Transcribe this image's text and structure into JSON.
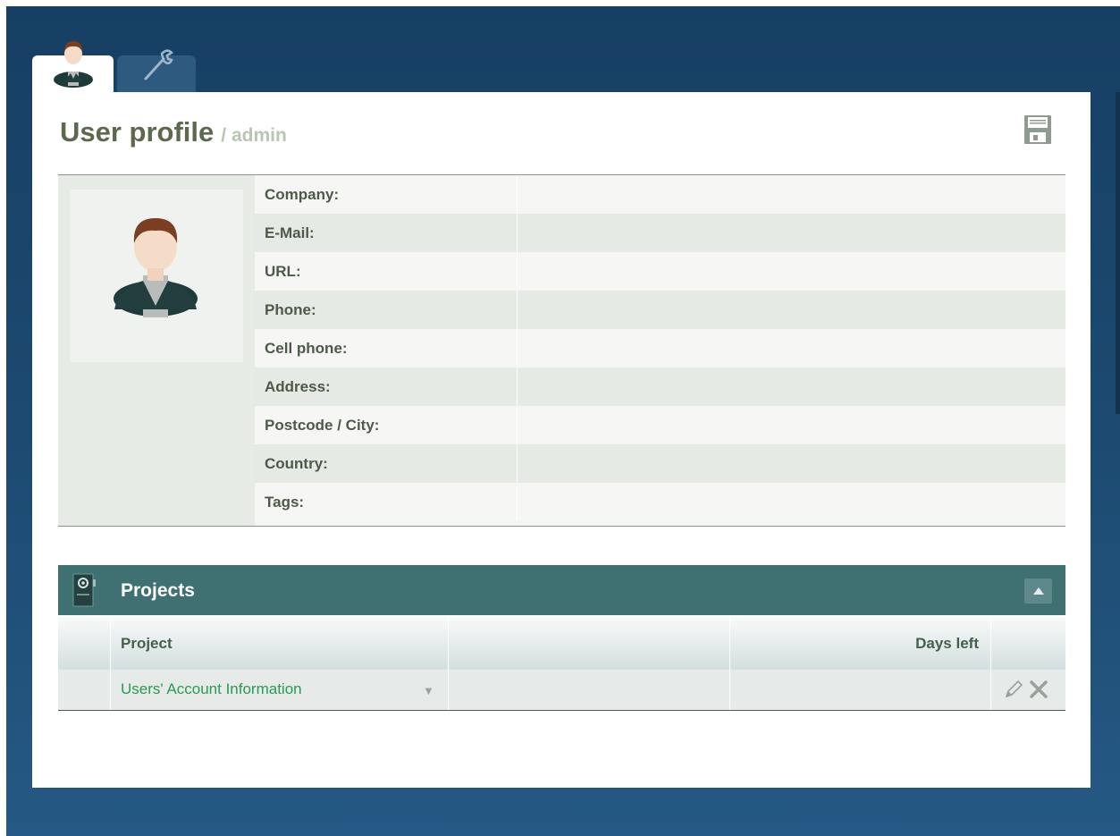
{
  "tabs": [
    {
      "name": "user-profile",
      "icon": "user-avatar-icon"
    },
    {
      "name": "settings",
      "icon": "wrench-icon"
    }
  ],
  "header": {
    "title": "User profile",
    "subtitle": "/ admin",
    "save_icon": "floppy-disk-icon"
  },
  "profile": {
    "avatar_icon": "user-avatar-icon",
    "fields": [
      {
        "label": "Company:",
        "value": ""
      },
      {
        "label": "E-Mail:",
        "value": ""
      },
      {
        "label": "URL:",
        "value": ""
      },
      {
        "label": "Phone:",
        "value": ""
      },
      {
        "label": "Cell phone:",
        "value": ""
      },
      {
        "label": "Address:",
        "value": ""
      },
      {
        "label": "Postcode / City:",
        "value": ""
      },
      {
        "label": "Country:",
        "value": ""
      },
      {
        "label": "Tags:",
        "value": ""
      }
    ]
  },
  "projects": {
    "title": "Projects",
    "icon": "project-binder-icon",
    "columns": {
      "project": "Project",
      "days_left": "Days left"
    },
    "rows": [
      {
        "project": "Users' Account Information",
        "days_left": ""
      }
    ]
  },
  "colors": {
    "background": "#1d4b72",
    "panel_header": "#3f7072",
    "title_text": "#5b6a4e",
    "link": "#2b9a52"
  }
}
